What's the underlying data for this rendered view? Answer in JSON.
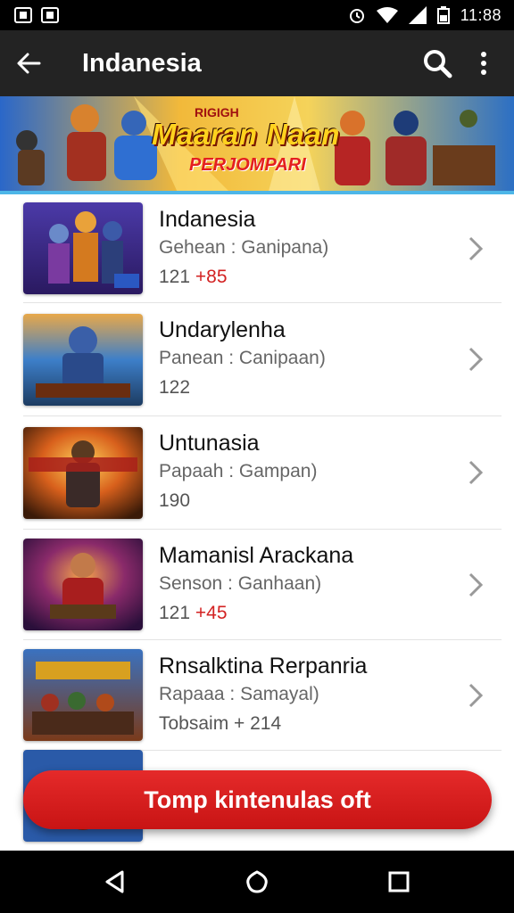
{
  "status_bar": {
    "time": "11:88"
  },
  "app_bar": {
    "title": "Indanesia"
  },
  "banner": {
    "top_text": "RIGIGH",
    "title": "Maaran Naan",
    "subtitle": "PERJOMPARI"
  },
  "list": [
    {
      "title": "Indanesia",
      "subtitle": "Gehean : Ganipana)",
      "meta_prefix": "121 ",
      "meta_highlight": "+85"
    },
    {
      "title": "Undarylenha",
      "subtitle": "Panean : Canipaan)",
      "meta_prefix": "122",
      "meta_highlight": ""
    },
    {
      "title": "Untunasia",
      "subtitle": "Papaah : Gampan)",
      "meta_prefix": "190",
      "meta_highlight": ""
    },
    {
      "title": "Mamanisl Arackana",
      "subtitle": "Senson : Ganhaan)",
      "meta_prefix": "121 ",
      "meta_highlight": "+45"
    },
    {
      "title": "Rnsalktina Rerpanria",
      "subtitle": "Rapaaa : Samayal)",
      "meta_prefix": "Tobsaim + 214",
      "meta_highlight": ""
    }
  ],
  "fab": {
    "label": "Tomp kintenulas oft"
  },
  "colors": {
    "app_bar": "#232323",
    "accent_red": "#d32222",
    "banner_border": "#4db6e8"
  },
  "icons": [
    "back-arrow-icon",
    "search-icon",
    "more-vert-icon",
    "chevron-right-icon",
    "nav-back-icon",
    "nav-home-icon",
    "nav-recents-icon"
  ]
}
